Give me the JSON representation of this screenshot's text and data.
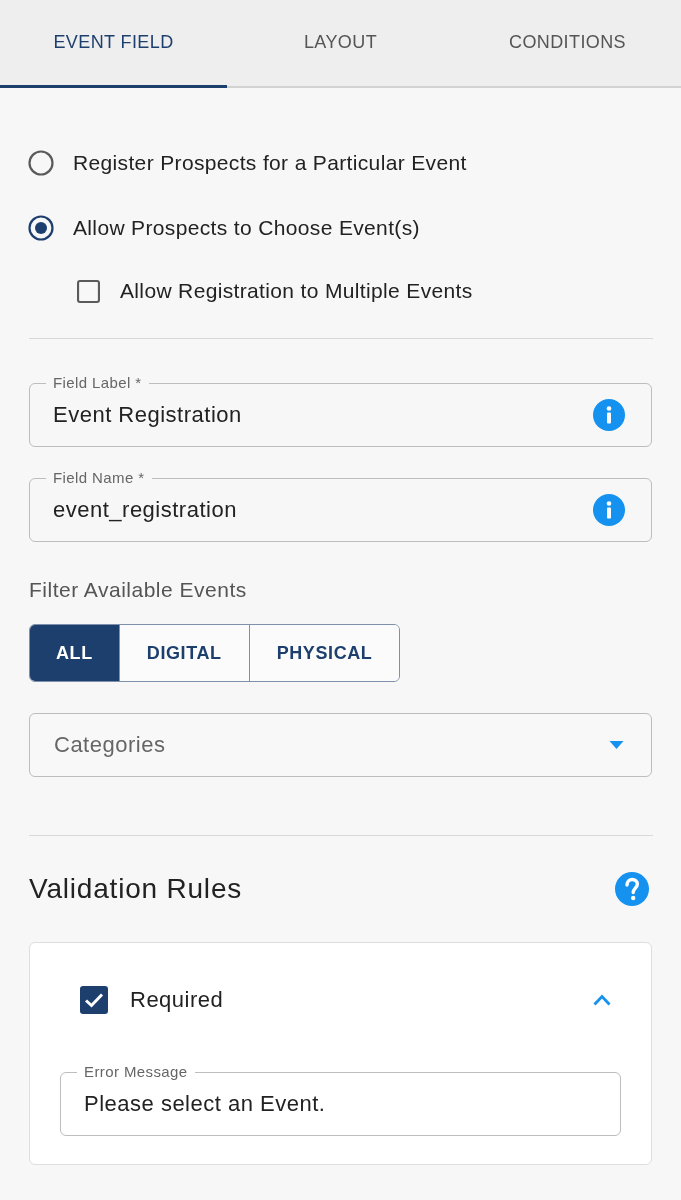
{
  "tabs": [
    {
      "label": "EVENT FIELD",
      "selected": true
    },
    {
      "label": "LAYOUT",
      "selected": false
    },
    {
      "label": "CONDITIONS",
      "selected": false
    }
  ],
  "registration_mode": {
    "options": [
      {
        "label": "Register Prospects for a Particular Event",
        "selected": false
      },
      {
        "label": "Allow Prospects to Choose Event(s)",
        "selected": true
      }
    ],
    "multiple_events": {
      "label": "Allow Registration to Multiple Events",
      "checked": false
    }
  },
  "fields": [
    {
      "label": "Field Label *",
      "value": "Event Registration"
    },
    {
      "label": "Field Name *",
      "value": "event_registration"
    }
  ],
  "filter": {
    "title": "Filter Available Events",
    "options": [
      {
        "label": "ALL",
        "selected": true
      },
      {
        "label": "DIGITAL",
        "selected": false
      },
      {
        "label": "PHYSICAL",
        "selected": false
      }
    ]
  },
  "categories": {
    "placeholder": "Categories"
  },
  "validation": {
    "title": "Validation Rules",
    "rules": [
      {
        "label": "Required",
        "checked": true,
        "expanded": true,
        "error_message": {
          "label": "Error Message",
          "value": "Please select an Event."
        }
      }
    ]
  }
}
